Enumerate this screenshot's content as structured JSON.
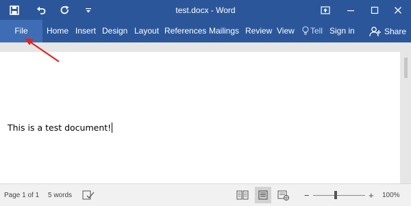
{
  "window": {
    "title": "test.docx - Word",
    "accent_color": "#2b579a"
  },
  "quick_access": [
    {
      "icon": "save-icon"
    },
    {
      "icon": "undo-icon"
    },
    {
      "icon": "redo-icon"
    },
    {
      "icon": "customize-toolbar-icon"
    }
  ],
  "window_controls": [
    {
      "icon": "ribbon-display-options-icon"
    },
    {
      "icon": "minimize-icon"
    },
    {
      "icon": "maximize-icon"
    },
    {
      "icon": "close-icon"
    }
  ],
  "ribbon": {
    "file_label": "File",
    "tabs": [
      "Home",
      "Insert",
      "Design",
      "Layout",
      "References",
      "Mailings",
      "Review",
      "View"
    ],
    "tell_label": "Tell",
    "signin_label": "Sign in",
    "share_label": "Share"
  },
  "document": {
    "text": "This is a test document!"
  },
  "status": {
    "page": "Page 1 of 1",
    "words": "5 words",
    "zoom_minus": "−",
    "zoom_plus": "+",
    "zoom": "100%",
    "view_modes": [
      "read-mode-icon",
      "print-layout-icon",
      "web-layout-icon"
    ]
  },
  "annotation": {
    "arrow_color": "#e8201a",
    "points_to": "File"
  }
}
